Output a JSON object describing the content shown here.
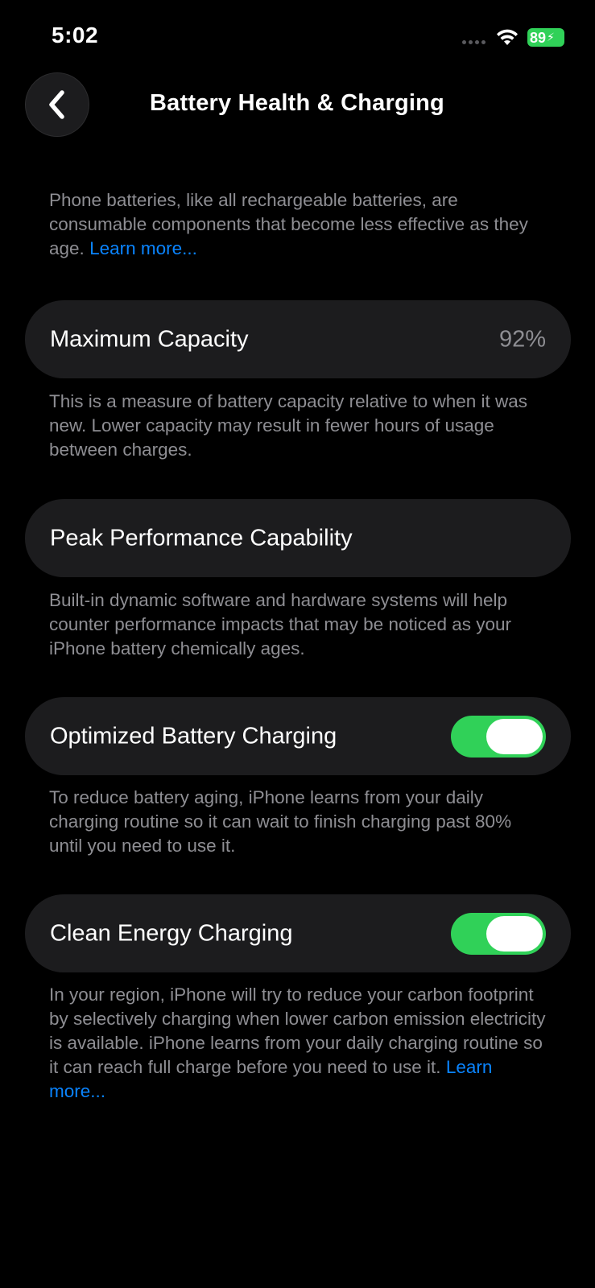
{
  "status_bar": {
    "time": "5:02",
    "battery_level": "89",
    "icons": [
      "cellular-signal-icon",
      "wifi-icon",
      "battery-charging-icon"
    ],
    "battery_color": "#30d158"
  },
  "nav": {
    "title": "Battery Health & Charging",
    "back_icon": "chevron-left-icon"
  },
  "intro": {
    "text": "Phone batteries, like all rechargeable batteries, are consumable components that become less effective as they age.",
    "link": "Learn more..."
  },
  "sections": {
    "max_capacity": {
      "label": "Maximum Capacity",
      "value": "92%",
      "footer": "This is a measure of battery capacity relative to when it was new. Lower capacity may result in fewer hours of usage between charges."
    },
    "peak_performance": {
      "label": "Peak Performance Capability",
      "footer": "Built-in dynamic software and hardware systems will help counter performance impacts that may be noticed as your iPhone battery chemically ages."
    },
    "optimized_charging": {
      "label": "Optimized Battery Charging",
      "enabled": true,
      "footer": "To reduce battery aging, iPhone learns from your daily charging routine so it can wait to finish charging past 80% until you need to use it."
    },
    "clean_energy": {
      "label": "Clean Energy Charging",
      "enabled": true,
      "footer": "In your region, iPhone will try to reduce your carbon footprint by selectively charging when lower carbon emission electricity is available. iPhone learns from your daily charging routine so it can reach full charge before you need to use it.",
      "link": "Learn more..."
    }
  },
  "colors": {
    "background": "#000000",
    "cell": "#1c1c1e",
    "toggle_on": "#30d158",
    "link": "#0a84ff",
    "secondary_text": "#8e8e93"
  }
}
